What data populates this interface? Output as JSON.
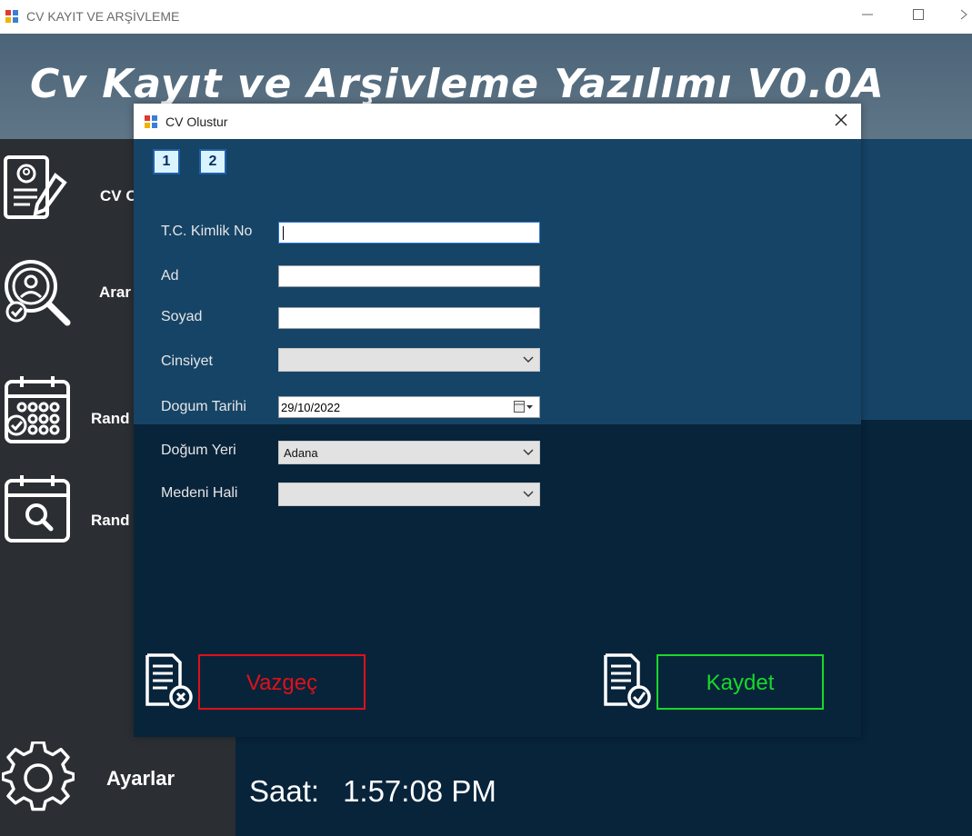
{
  "window": {
    "title": "CV KAYIT VE ARŞİVLEME",
    "minimize_icon": "minimize-icon",
    "maximize_icon": "maximize-icon",
    "close_icon": "close-icon"
  },
  "header": {
    "app_title": "Cv Kayıt ve Arşivleme Yazılımı V0.0A"
  },
  "sidebar": {
    "items": [
      {
        "label": "CV O",
        "icon": "cv-document-icon"
      },
      {
        "label": "Arar",
        "icon": "search-person-icon"
      },
      {
        "label": "Rand",
        "icon": "calendar-icon"
      },
      {
        "label": "Rand",
        "icon": "calendar-search-icon"
      }
    ],
    "settings": {
      "label": "Ayarlar",
      "icon": "gear-icon"
    }
  },
  "status": {
    "clock_label": "Saat:",
    "clock_value": "1:57:08 PM"
  },
  "dialog": {
    "title": "CV Olustur",
    "pages": [
      "1",
      "2"
    ],
    "fields": {
      "tc_label": "T.C. Kimlik No",
      "tc_value": "",
      "ad_label": "Ad",
      "ad_value": "",
      "soyad_label": "Soyad",
      "soyad_value": "",
      "cinsiyet_label": "Cinsiyet",
      "cinsiyet_value": "",
      "dogum_tarihi_label": "Dogum Tarihi",
      "dogum_tarihi_value": "29/10/2022",
      "dogum_yeri_label": "Doğum Yeri",
      "dogum_yeri_value": "Adana",
      "medeni_hali_label": "Medeni Hali",
      "medeni_hali_value": ""
    },
    "buttons": {
      "cancel_label": "Vazgeç",
      "save_label": "Kaydet"
    }
  },
  "colors": {
    "header_bg": "#5a7183",
    "sidebar_bg": "#2b2f33",
    "main_upper_bg": "#164466",
    "main_lower_bg": "#07243b",
    "cancel_red": "#e0101a",
    "save_green": "#17d92a"
  }
}
